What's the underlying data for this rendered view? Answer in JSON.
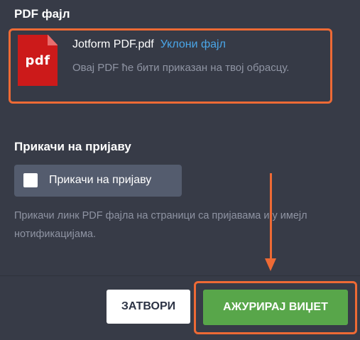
{
  "pdf_section": {
    "title": "PDF фајл",
    "icon_label": "pdf",
    "file_name": "Jotform PDF.pdf",
    "remove_label": "Уклони фајл",
    "description": "Овај PDF ће бити приказан на твој обрасцу."
  },
  "attach_section": {
    "title": "Прикачи на пријаву",
    "checkbox_label": "Прикачи на пријаву",
    "checked": false,
    "help_text": "Прикачи линк PDF фајла на страници са пријавама и у имејл нотификацијама."
  },
  "footer": {
    "close_label": "ЗАТВОРИ",
    "update_label": "АЖУРИРАЈ ВИЏЕТ"
  },
  "colors": {
    "background": "#373b47",
    "highlight": "#ee6a35",
    "link": "#4aa6e8",
    "primary_button": "#58a64a",
    "pdf_icon": "#cc1a1a"
  }
}
